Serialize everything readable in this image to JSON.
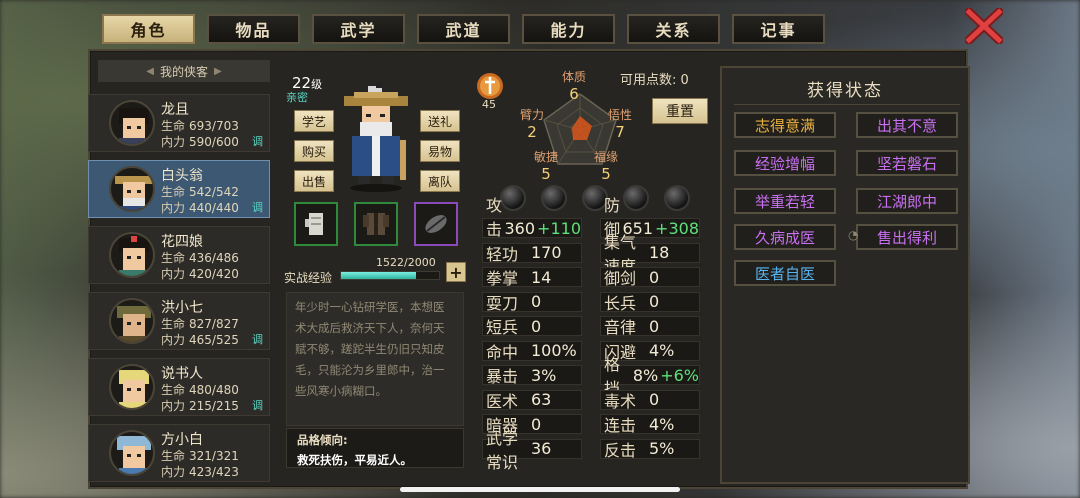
{
  "tabs": [
    "角色",
    "物品",
    "武学",
    "武道",
    "能力",
    "关系",
    "记事"
  ],
  "active_tab": 0,
  "list_header": "我的侠客",
  "characters": [
    {
      "name": "龙且",
      "hp": "693/703",
      "mp": "590/600",
      "hp_label": "生命",
      "mp_label": "内力",
      "tune": "调"
    },
    {
      "name": "白头翁",
      "hp": "542/542",
      "mp": "440/440",
      "hp_label": "生命",
      "mp_label": "内力",
      "tune": "调",
      "selected": true
    },
    {
      "name": "花四娘",
      "hp": "436/486",
      "mp": "420/420",
      "hp_label": "生命",
      "mp_label": "内力",
      "tune": ""
    },
    {
      "name": "洪小七",
      "hp": "827/827",
      "mp": "465/525",
      "hp_label": "生命",
      "mp_label": "内力",
      "tune": "调"
    },
    {
      "name": "说书人",
      "hp": "480/480",
      "mp": "215/215",
      "hp_label": "生命",
      "mp_label": "内力",
      "tune": "调"
    },
    {
      "name": "方小白",
      "hp": "321/321",
      "mp": "423/423",
      "hp_label": "生命",
      "mp_label": "内力",
      "tune": ""
    }
  ],
  "profile": {
    "level": "22",
    "level_unit": "级",
    "relation": "亲密",
    "buttons_left": [
      "学艺",
      "购买",
      "出售"
    ],
    "buttons_right": [
      "送礼",
      "易物",
      "离队"
    ],
    "exp_label": "实战经验",
    "exp_value": "1522/2000",
    "exp_fraction": 0.761,
    "bio": "年少时一心钻研学医，本想医术大成后救济天下人，奈何天赋不够，蹉跎半生仍旧只知皮毛，只能沦为乡里郎中，治一些风寒小病糊口。",
    "trait_title": "品格倾向:",
    "trait_text": "救死扶伤，平易近人。"
  },
  "attributes": {
    "points_label": "可用点数:",
    "points": "0",
    "reset_label": "重置",
    "badge_value": "45",
    "items": [
      {
        "name": "体质",
        "value": "6"
      },
      {
        "name": "悟性",
        "value": "7"
      },
      {
        "name": "福缘",
        "value": "5"
      },
      {
        "name": "敏捷",
        "value": "5"
      },
      {
        "name": "臂力",
        "value": "2"
      }
    ]
  },
  "stats": [
    {
      "k": "攻击力",
      "v": "360",
      "b": "+110"
    },
    {
      "k": "防御力",
      "v": "651",
      "b": "+308"
    },
    {
      "k": "轻功",
      "v": "170",
      "b": ""
    },
    {
      "k": "集气速度",
      "v": "18",
      "b": ""
    },
    {
      "k": "拳掌",
      "v": "14",
      "b": ""
    },
    {
      "k": "御剑",
      "v": "0",
      "b": ""
    },
    {
      "k": "耍刀",
      "v": "0",
      "b": ""
    },
    {
      "k": "长兵",
      "v": "0",
      "b": ""
    },
    {
      "k": "短兵",
      "v": "0",
      "b": ""
    },
    {
      "k": "音律",
      "v": "0",
      "b": ""
    },
    {
      "k": "命中",
      "v": "100%",
      "b": ""
    },
    {
      "k": "闪避",
      "v": "4%",
      "b": ""
    },
    {
      "k": "暴击",
      "v": "3%",
      "b": ""
    },
    {
      "k": "格挡",
      "v": "8%",
      "b": "+6%"
    },
    {
      "k": "医术",
      "v": "63",
      "b": ""
    },
    {
      "k": "毒术",
      "v": "0",
      "b": ""
    },
    {
      "k": "暗器",
      "v": "0",
      "b": ""
    },
    {
      "k": "连击",
      "v": "4%",
      "b": ""
    },
    {
      "k": "武学常识",
      "v": "36",
      "b": ""
    },
    {
      "k": "反击",
      "v": "5%",
      "b": ""
    }
  ],
  "status": {
    "title": "获得状态",
    "items": [
      {
        "label": "志得意满",
        "color": "gold"
      },
      {
        "label": "出其不意",
        "color": "purple"
      },
      {
        "label": "经验增幅",
        "color": "purple"
      },
      {
        "label": "坚若磐石",
        "color": "purple"
      },
      {
        "label": "举重若轻",
        "color": "purple"
      },
      {
        "label": "江湖郎中",
        "color": "purple"
      },
      {
        "label": "久病成医",
        "color": "purple"
      },
      {
        "label": "售出得利",
        "color": "purple"
      },
      {
        "label": "医者自医",
        "color": "blue"
      }
    ]
  }
}
